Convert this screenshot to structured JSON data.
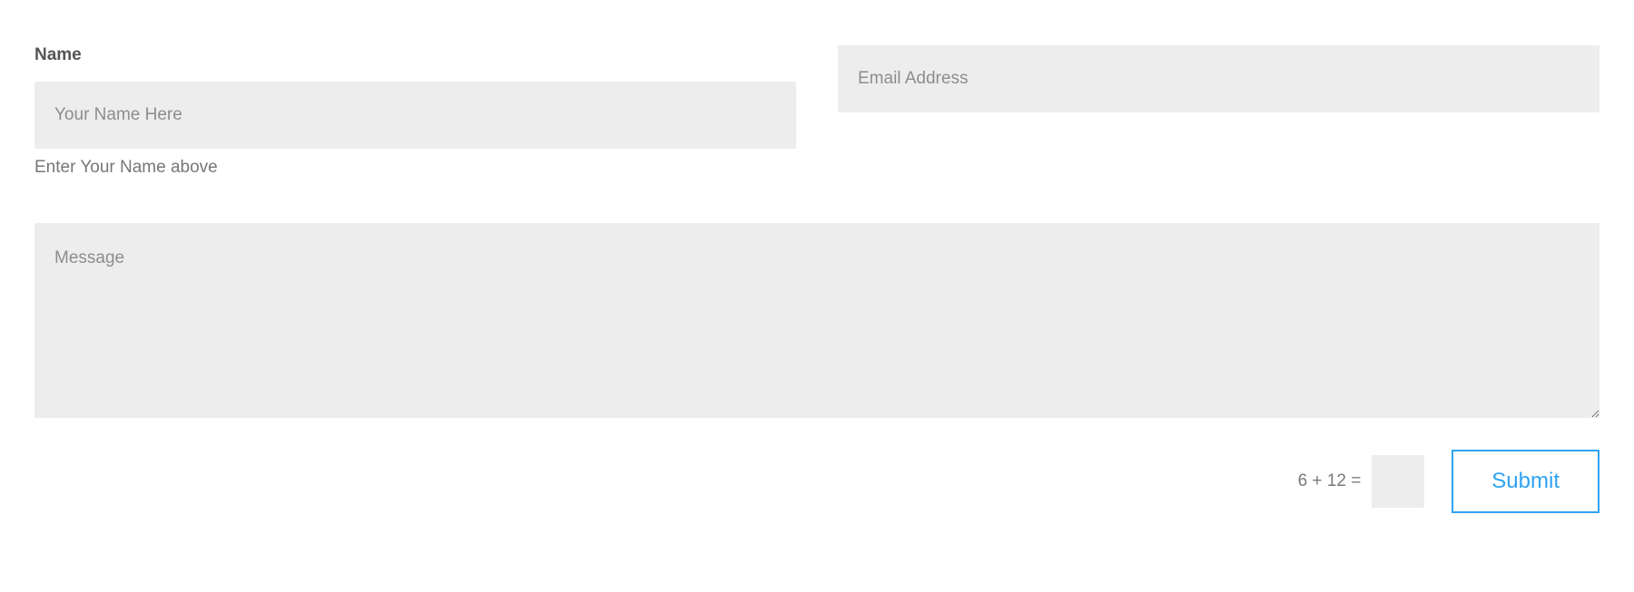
{
  "form": {
    "name": {
      "label": "Name",
      "placeholder": "Your Name Here",
      "help": "Enter Your Name above"
    },
    "email": {
      "placeholder": "Email Address"
    },
    "message": {
      "placeholder": "Message"
    },
    "captcha": {
      "question": "6 + 12 ="
    },
    "submit": {
      "label": "Submit"
    }
  }
}
